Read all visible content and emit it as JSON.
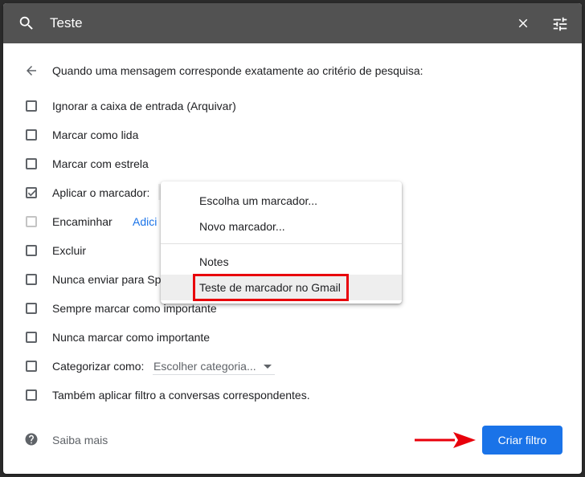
{
  "search": {
    "query": "Teste"
  },
  "filter": {
    "header": "Quando uma mensagem corresponde exatamente ao critério de pesquisa:",
    "options": [
      {
        "label": "Ignorar a caixa de entrada (Arquivar)",
        "checked": false
      },
      {
        "label": "Marcar como lida",
        "checked": false
      },
      {
        "label": "Marcar com estrela",
        "checked": false
      },
      {
        "label": "Aplicar o marcador:",
        "checked": true
      },
      {
        "label": "Encaminhar",
        "checked": false,
        "disabled": true,
        "link": "Adici"
      },
      {
        "label": "Excluir",
        "checked": false
      },
      {
        "label": "Nunca enviar para Sp",
        "checked": false
      },
      {
        "label": "Sempre marcar como importante",
        "checked": false
      },
      {
        "label": "Nunca marcar como importante",
        "checked": false
      },
      {
        "label": "Categorizar como:",
        "checked": false,
        "select_value": "Escolher categoria..."
      },
      {
        "label": "Também aplicar filtro a conversas correspondentes.",
        "checked": false
      }
    ]
  },
  "label_menu": {
    "items": [
      "Escolha um marcador...",
      "Novo marcador...",
      "Notes",
      "Teste de marcador no Gmail"
    ],
    "hovered_index": 3
  },
  "footer": {
    "help_link": "Saiba mais",
    "create_button": "Criar filtro"
  },
  "colors": {
    "accent": "#1a73e8",
    "annotation_red": "#e8000b",
    "searchbar": "#525252"
  },
  "icons": {
    "search": "search-icon",
    "close": "close-icon",
    "tune": "tune-icon",
    "back": "back-arrow-icon",
    "help": "help-icon",
    "check": "check-icon",
    "annotation_arrow": "red-arrow-icon"
  }
}
